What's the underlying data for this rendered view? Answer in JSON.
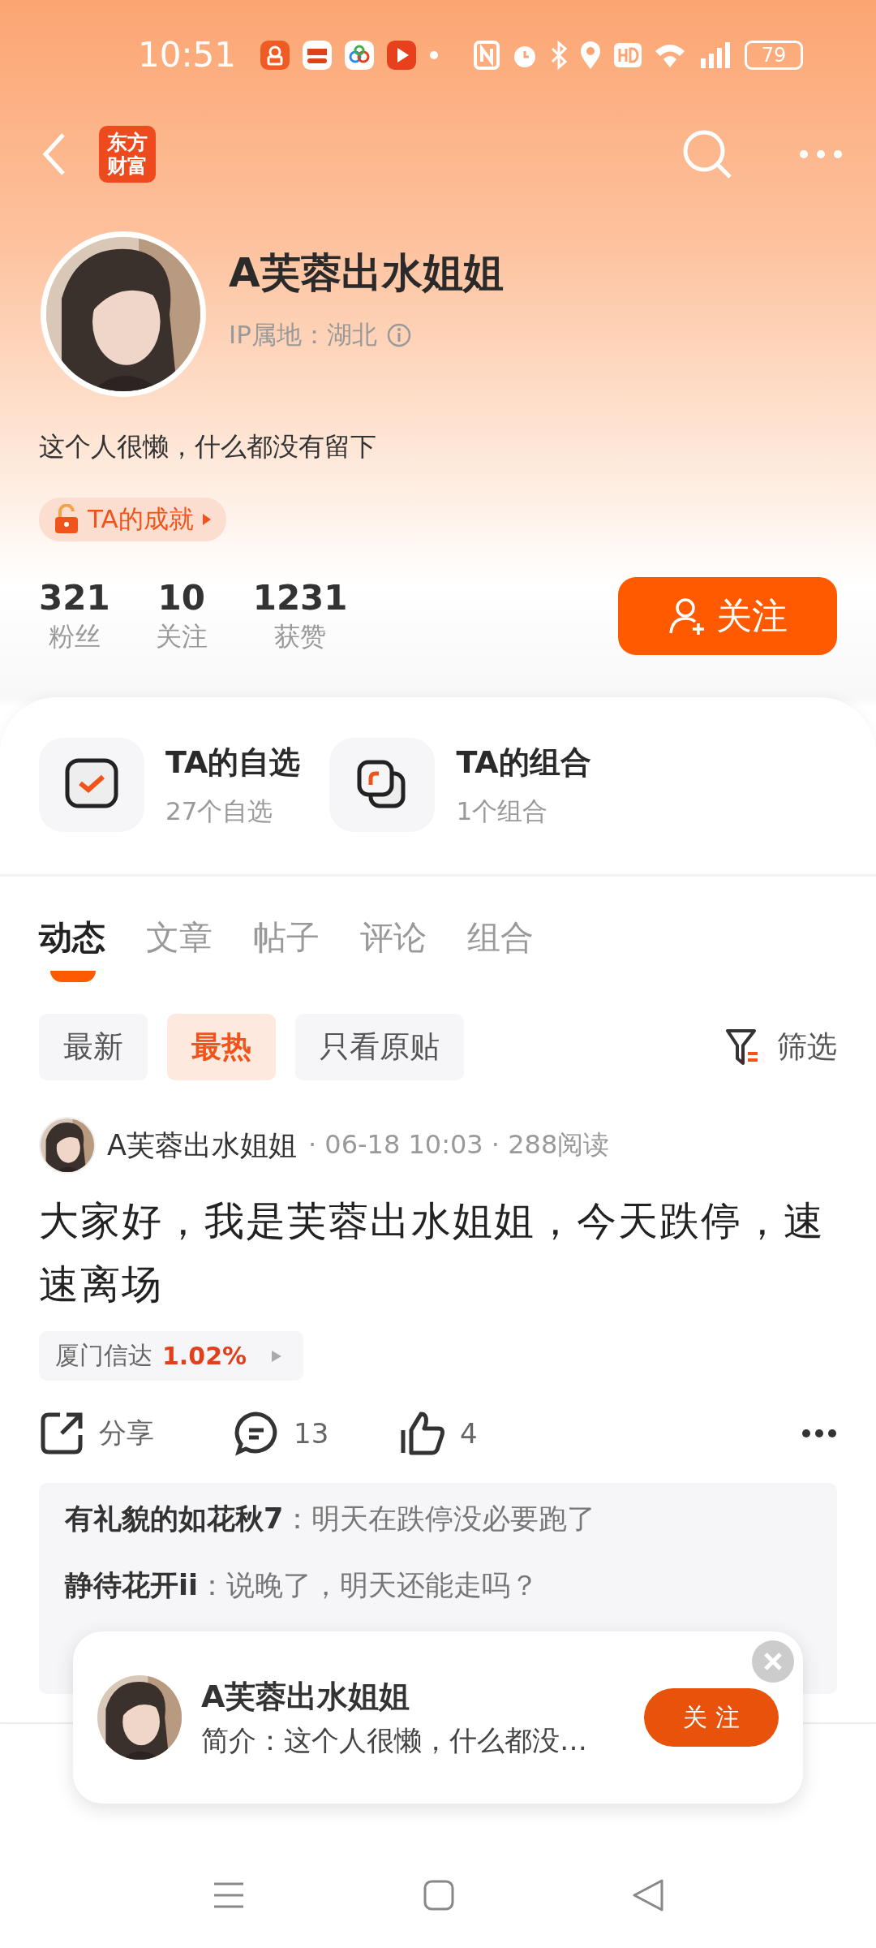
{
  "status_bar": {
    "time": "10:51",
    "battery": "79"
  },
  "header": {
    "logo_lines": [
      "东方",
      "财富"
    ]
  },
  "profile": {
    "name": "A芙蓉出水姐姐",
    "ip_label": "IP属地：湖北",
    "bio": "这个人很懒，什么都没有留下",
    "achievement": "TA的成就"
  },
  "stats": [
    {
      "value": "321",
      "label": "粉丝"
    },
    {
      "value": "10",
      "label": "关注"
    },
    {
      "value": "1231",
      "label": "获赞"
    }
  ],
  "follow_button": "关注",
  "shortcuts": [
    {
      "kind": "watchlist",
      "title": "TA的自选",
      "subtitle": "27个自选"
    },
    {
      "kind": "portfolio",
      "title": "TA的组合",
      "subtitle": "1个组合"
    }
  ],
  "tabs": [
    {
      "label": "动态",
      "selected": true
    },
    {
      "label": "文章",
      "selected": false
    },
    {
      "label": "帖子",
      "selected": false
    },
    {
      "label": "评论",
      "selected": false
    },
    {
      "label": "组合",
      "selected": false
    }
  ],
  "filters": [
    {
      "label": "最新",
      "selected": false
    },
    {
      "label": "最热",
      "selected": true
    },
    {
      "label": "只看原贴",
      "selected": false
    }
  ],
  "filter_button": "筛选",
  "post": {
    "author": "A芙蓉出水姐姐",
    "meta": "· 06-18 10:03 · 288阅读",
    "text": "大家好，我是芙蓉出水姐姐，今天跌停，速速离场",
    "stock": {
      "name": "厦门信达",
      "change": "1.02%"
    },
    "share": "分享",
    "comments": "13",
    "likes": "4",
    "replies": [
      "**有礼貌的如花秋7**：明天在跌停没必要跑了",
      "**静待花开ii**：说晚了，明天还能走吗？"
    ]
  },
  "popup": {
    "name": "A芙蓉出水姐姐",
    "intro": "简介：这个人很懒，什么都没…",
    "button": "关 注"
  }
}
